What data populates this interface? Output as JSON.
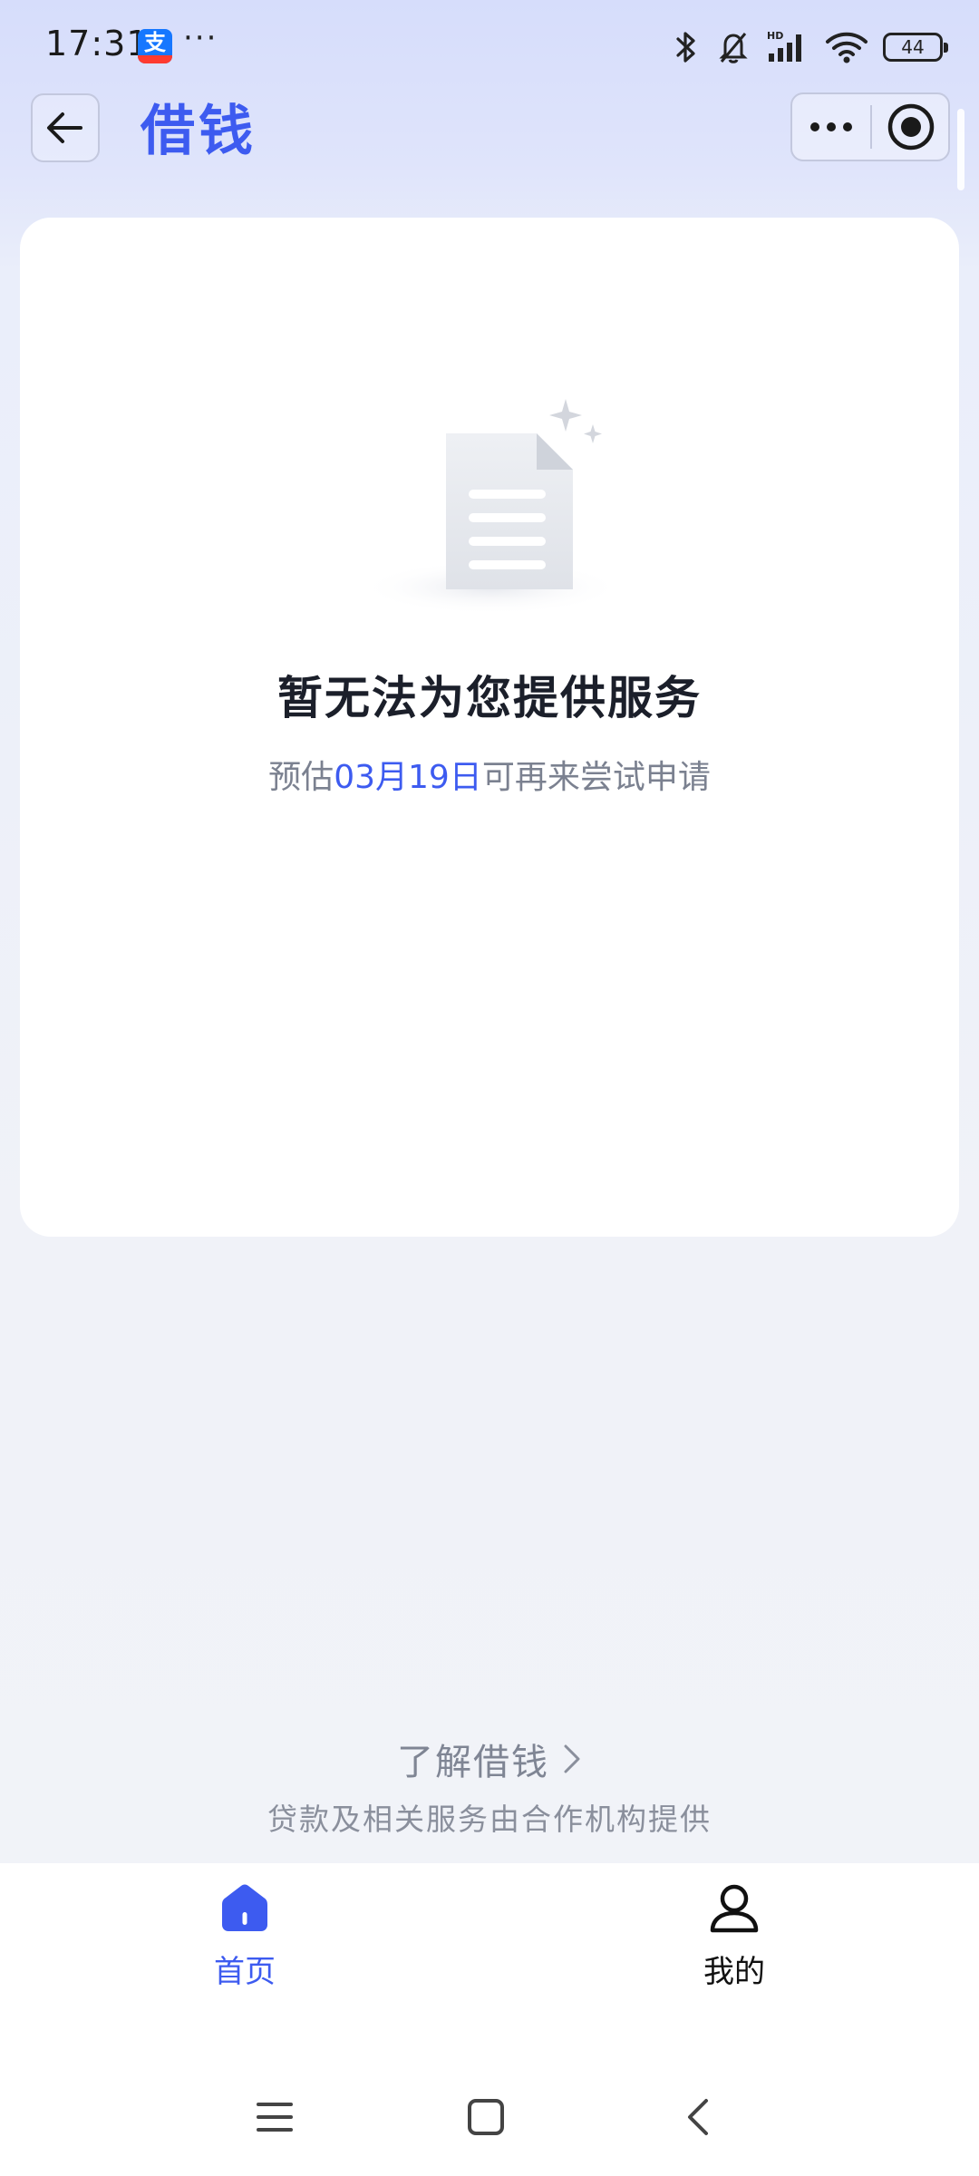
{
  "status_bar": {
    "time": "17:31",
    "app_badge": "支",
    "overflow": "···",
    "network_label": "HD",
    "battery": "44"
  },
  "header": {
    "title": "借钱"
  },
  "empty_state": {
    "title": "暂无法为您提供服务",
    "subtitle_prefix": "预估",
    "subtitle_date": "03月19日",
    "subtitle_suffix": "可再来尝试申请"
  },
  "footer": {
    "learn_more": "了解借钱",
    "disclaimer": "贷款及相关服务由合作机构提供"
  },
  "tab_bar": {
    "tabs": [
      {
        "label": "首页",
        "icon": "home-icon",
        "active": true
      },
      {
        "label": "我的",
        "icon": "user-icon",
        "active": false
      }
    ]
  },
  "colors": {
    "accent": "#3d5bf0",
    "title_text": "#1b1f2a",
    "muted_text": "#7b8190"
  }
}
